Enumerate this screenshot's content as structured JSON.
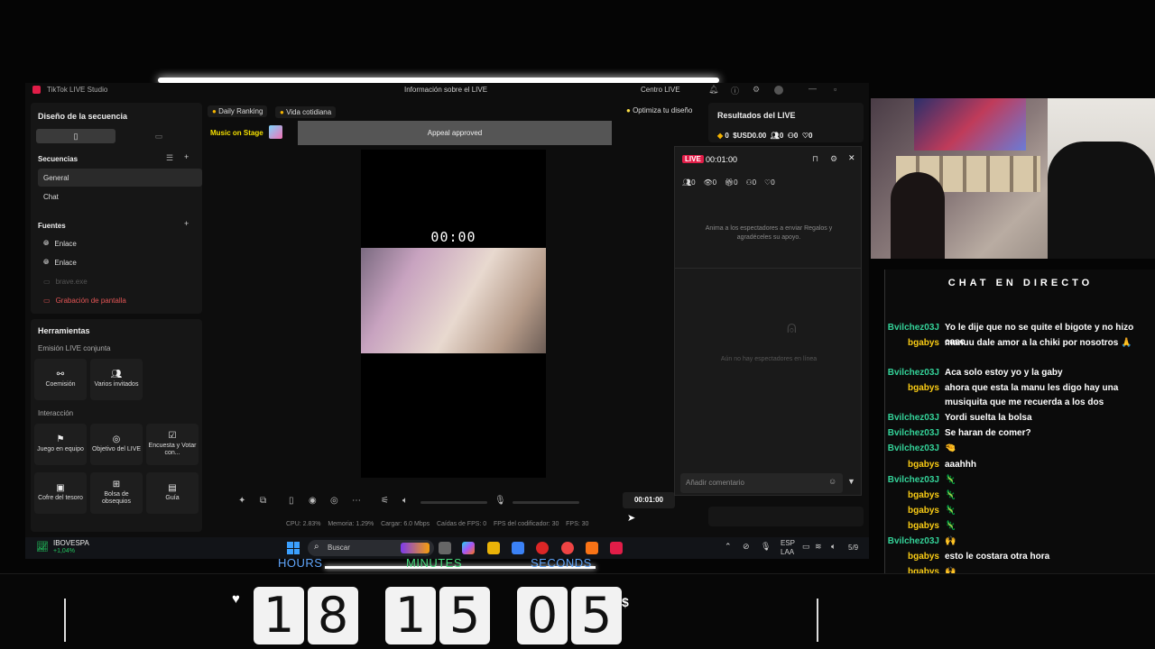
{
  "app": {
    "title": "TikTok LIVE Studio",
    "center_title": "Información sobre el LIVE",
    "right_title": "Centro LIVE"
  },
  "left": {
    "layout_title": "Diseño de la secuencia",
    "sequences_title": "Secuencias",
    "seq_items": [
      "General",
      "Chat"
    ],
    "sources_title": "Fuentes",
    "sources": [
      "Enlace",
      "Enlace",
      "brave.exe",
      "Grabación de pantalla"
    ],
    "tools_title": "Herramientas",
    "colive_title": "Emisión LIVE conjunta",
    "colive": [
      {
        "label": "Coemisión",
        "icon": "link-icon"
      },
      {
        "label": "Varios invitados",
        "icon": "people-icon"
      }
    ],
    "interaction_title": "Interacción",
    "interaction": [
      {
        "label": "Juego en equipo",
        "icon": "game-icon"
      },
      {
        "label": "Objetivo del LIVE",
        "icon": "target-icon"
      },
      {
        "label": "Encuesta y Votar con...",
        "icon": "poll-icon"
      },
      {
        "label": "Cofre del tesoro",
        "icon": "chest-icon"
      },
      {
        "label": "Bolsa de obsequios",
        "icon": "gift-bag-icon"
      },
      {
        "label": "Guía",
        "icon": "book-icon"
      }
    ]
  },
  "center": {
    "tags": [
      "Daily Ranking",
      "Vida cotidiana"
    ],
    "music": "Music on Stage",
    "banner": "Appeal approved",
    "optimize": "Optimiza tu diseño",
    "timer": "00:00",
    "duration": "00:01:00"
  },
  "stats": {
    "cpu": "CPU: 2.83%",
    "mem": "Memoria: 1.29%",
    "load": "Cargar: 6.0 Mbps",
    "drops": "Caídas de FPS: 0",
    "enc": "FPS del codificador: 30",
    "fps": "FPS: 30"
  },
  "results": {
    "title": "Resultados del LIVE",
    "values": [
      "0",
      "USD0.00",
      "0",
      "0",
      "0"
    ]
  },
  "live_popup": {
    "badge": "LIVE",
    "time": "00:01:00",
    "counts": [
      "0",
      "0",
      "0",
      "0",
      "0"
    ],
    "hint": "Anima a los espectadores a enviar Regalos y agradéceles su apoyo.",
    "empty": "Aún no hay espectadores en línea",
    "comment_placeholder": "Añadir comentario"
  },
  "taskbar": {
    "ticker": "IBOVESPA",
    "ticker_change": "+1,04%",
    "search": "Buscar",
    "lang1": "ESP",
    "lang2": "LAA",
    "time": "5/9"
  },
  "chat": {
    "title": "CHAT EN DIRECTO",
    "messages": [
      {
        "user": "Bvilchez03J",
        "text": "Yo le dije que no se quite el bigote y no hizo caso",
        "color": "#34d399"
      },
      {
        "user": "bgabys",
        "text": "manuu dale amor a la chiki por nosotros 🙏",
        "color": "#facc15"
      },
      {
        "user": "Bvilchez03J",
        "text": "Aca solo estoy yo y la gaby",
        "color": "#34d399"
      },
      {
        "user": "bgabys",
        "text": "ahora que esta la manu les digo hay una musiquita que me recuerda a los dos",
        "color": "#facc15"
      },
      {
        "user": "Bvilchez03J",
        "text": "Yordi suelta la bolsa",
        "color": "#34d399"
      },
      {
        "user": "Bvilchez03J",
        "text": "Se haran de comer?",
        "color": "#34d399"
      },
      {
        "user": "Bvilchez03J",
        "text": "🤏",
        "color": "#34d399"
      },
      {
        "user": "bgabys",
        "text": "aaahhh",
        "color": "#facc15"
      },
      {
        "user": "Bvilchez03J",
        "text": "🦎",
        "color": "#34d399"
      },
      {
        "user": "bgabys",
        "text": "🦎",
        "color": "#facc15"
      },
      {
        "user": "bgabys",
        "text": "🦎",
        "color": "#facc15"
      },
      {
        "user": "bgabys",
        "text": "🦎",
        "color": "#facc15"
      },
      {
        "user": "Bvilchez03J",
        "text": "🙌",
        "color": "#34d399"
      },
      {
        "user": "bgabys",
        "text": "esto le costara otra hora",
        "color": "#facc15"
      },
      {
        "user": "bgabys",
        "text": "🙌",
        "color": "#facc15"
      }
    ]
  },
  "timer": {
    "labels": [
      "HOURS",
      "MINUTES",
      "SECONDS"
    ],
    "digits": [
      "1",
      "8",
      "1",
      "5",
      "0",
      "5"
    ],
    "heart": "♥",
    "dollar": "$"
  }
}
